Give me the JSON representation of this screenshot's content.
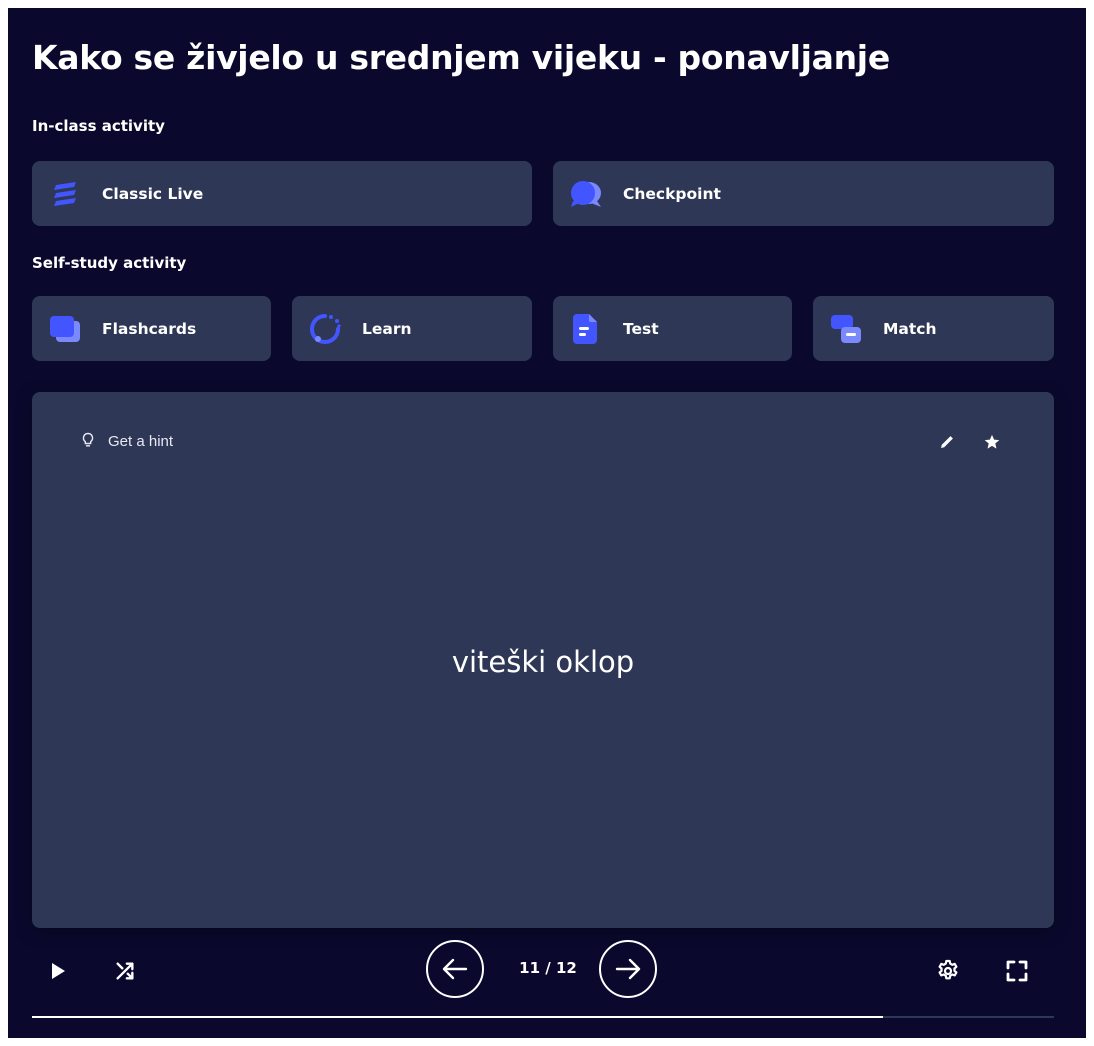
{
  "page": {
    "title": "Kako se živjelo u srednjem vijeku - ponavljanje"
  },
  "in_class": {
    "label": "In-class activity",
    "items": [
      {
        "label": "Classic Live",
        "icon": "classic-live-icon"
      },
      {
        "label": "Checkpoint",
        "icon": "checkpoint-icon"
      }
    ]
  },
  "self_study": {
    "label": "Self-study activity",
    "items": [
      {
        "label": "Flashcards",
        "icon": "flashcards-icon"
      },
      {
        "label": "Learn",
        "icon": "learn-icon"
      },
      {
        "label": "Test",
        "icon": "test-icon"
      },
      {
        "label": "Match",
        "icon": "match-icon"
      }
    ]
  },
  "flashcard": {
    "hint_label": "Get a hint",
    "term": "viteški oklop"
  },
  "controls": {
    "counter": "11 / 12",
    "current": 11,
    "total": 12,
    "progress_fraction": 0.833
  },
  "colors": {
    "background": "#0a092d",
    "card": "#2e3856",
    "accent": "#4255ff",
    "accent_light": "#7b89ff"
  }
}
